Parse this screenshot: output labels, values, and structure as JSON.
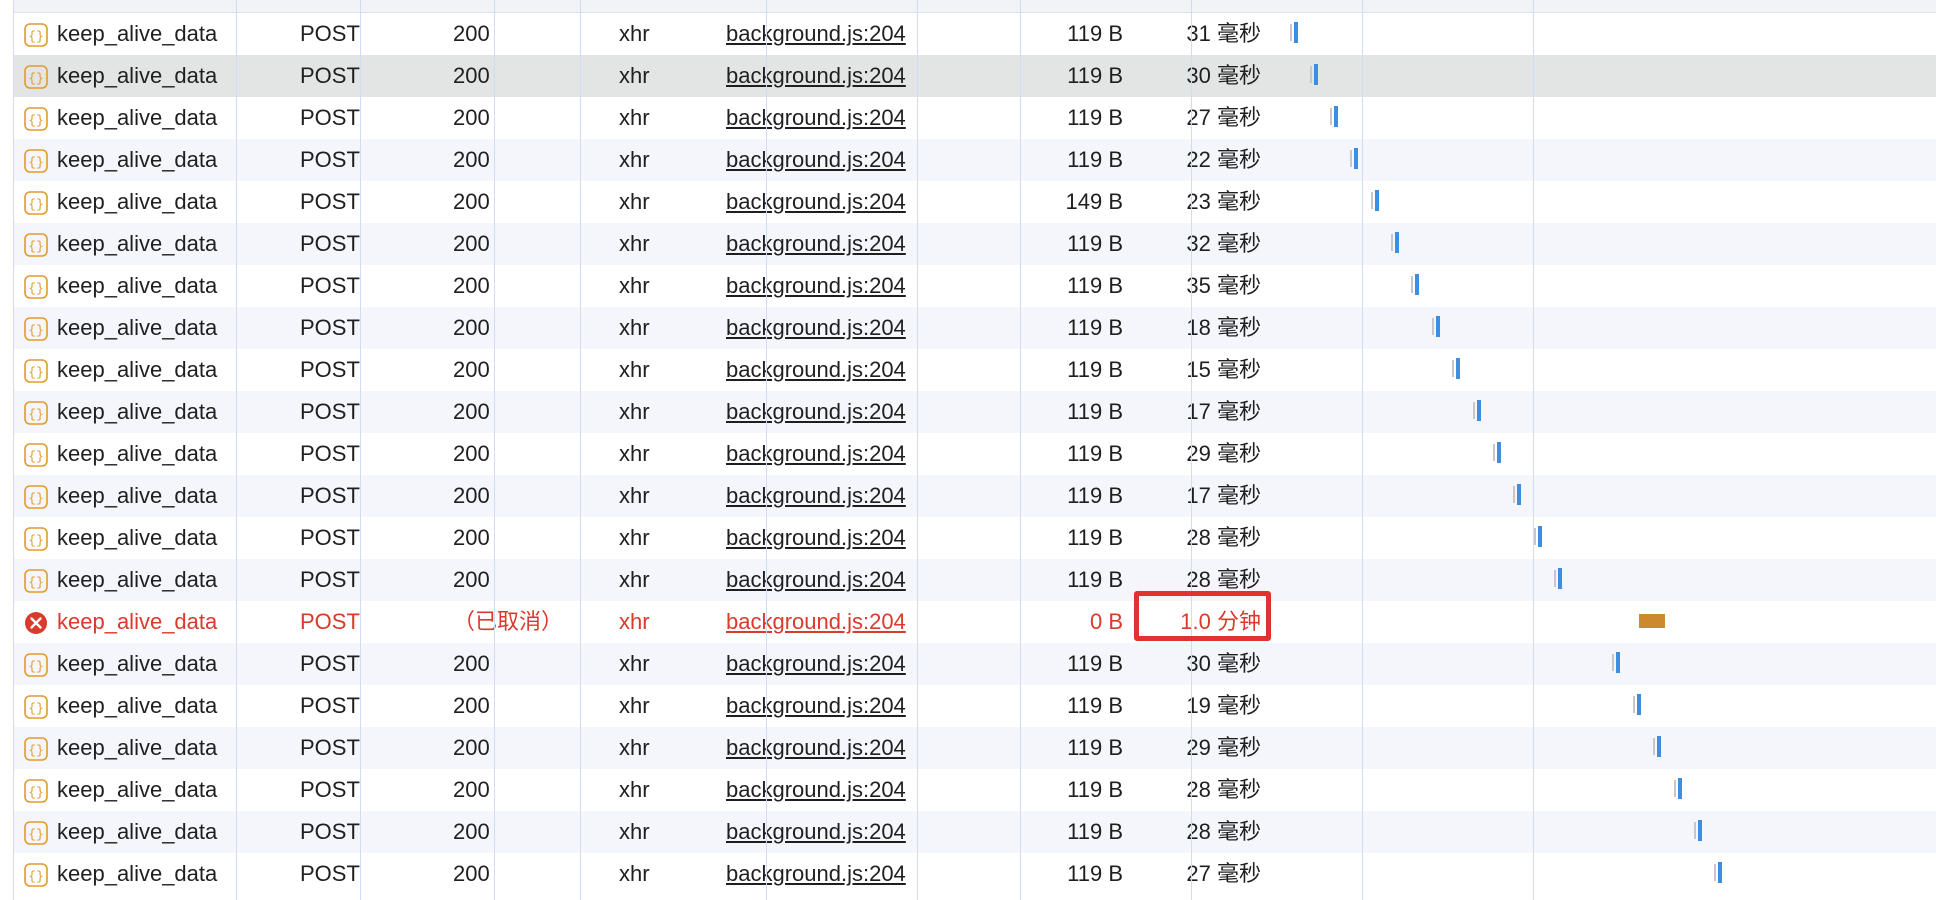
{
  "requests": [
    {
      "name": "keep_alive_data",
      "method": "POST",
      "status": "200",
      "type": "xhr",
      "initiator": "background.js:204",
      "size": "119 B",
      "time": "31 毫秒",
      "icon": "json-braces-icon",
      "state": "ok"
    },
    {
      "name": "keep_alive_data",
      "method": "POST",
      "status": "200",
      "type": "xhr",
      "initiator": "background.js:204",
      "size": "119 B",
      "time": "30 毫秒",
      "icon": "json-braces-icon",
      "state": "ok",
      "selected": true
    },
    {
      "name": "keep_alive_data",
      "method": "POST",
      "status": "200",
      "type": "xhr",
      "initiator": "background.js:204",
      "size": "119 B",
      "time": "27 毫秒",
      "icon": "json-braces-icon",
      "state": "ok"
    },
    {
      "name": "keep_alive_data",
      "method": "POST",
      "status": "200",
      "type": "xhr",
      "initiator": "background.js:204",
      "size": "119 B",
      "time": "22 毫秒",
      "icon": "json-braces-icon",
      "state": "ok"
    },
    {
      "name": "keep_alive_data",
      "method": "POST",
      "status": "200",
      "type": "xhr",
      "initiator": "background.js:204",
      "size": "149 B",
      "time": "23 毫秒",
      "icon": "json-braces-icon",
      "state": "ok"
    },
    {
      "name": "keep_alive_data",
      "method": "POST",
      "status": "200",
      "type": "xhr",
      "initiator": "background.js:204",
      "size": "119 B",
      "time": "32 毫秒",
      "icon": "json-braces-icon",
      "state": "ok"
    },
    {
      "name": "keep_alive_data",
      "method": "POST",
      "status": "200",
      "type": "xhr",
      "initiator": "background.js:204",
      "size": "119 B",
      "time": "35 毫秒",
      "icon": "json-braces-icon",
      "state": "ok"
    },
    {
      "name": "keep_alive_data",
      "method": "POST",
      "status": "200",
      "type": "xhr",
      "initiator": "background.js:204",
      "size": "119 B",
      "time": "18 毫秒",
      "icon": "json-braces-icon",
      "state": "ok"
    },
    {
      "name": "keep_alive_data",
      "method": "POST",
      "status": "200",
      "type": "xhr",
      "initiator": "background.js:204",
      "size": "119 B",
      "time": "15 毫秒",
      "icon": "json-braces-icon",
      "state": "ok"
    },
    {
      "name": "keep_alive_data",
      "method": "POST",
      "status": "200",
      "type": "xhr",
      "initiator": "background.js:204",
      "size": "119 B",
      "time": "17 毫秒",
      "icon": "json-braces-icon",
      "state": "ok"
    },
    {
      "name": "keep_alive_data",
      "method": "POST",
      "status": "200",
      "type": "xhr",
      "initiator": "background.js:204",
      "size": "119 B",
      "time": "29 毫秒",
      "icon": "json-braces-icon",
      "state": "ok"
    },
    {
      "name": "keep_alive_data",
      "method": "POST",
      "status": "200",
      "type": "xhr",
      "initiator": "background.js:204",
      "size": "119 B",
      "time": "17 毫秒",
      "icon": "json-braces-icon",
      "state": "ok"
    },
    {
      "name": "keep_alive_data",
      "method": "POST",
      "status": "200",
      "type": "xhr",
      "initiator": "background.js:204",
      "size": "119 B",
      "time": "28 毫秒",
      "icon": "json-braces-icon",
      "state": "ok"
    },
    {
      "name": "keep_alive_data",
      "method": "POST",
      "status": "200",
      "type": "xhr",
      "initiator": "background.js:204",
      "size": "119 B",
      "time": "28 毫秒",
      "icon": "json-braces-icon",
      "state": "ok"
    },
    {
      "name": "keep_alive_data",
      "method": "POST",
      "status": "（已取消）",
      "type": "xhr",
      "initiator": "background.js:204",
      "size": "0 B",
      "time": "1.0 分钟",
      "icon": "error-x-icon",
      "state": "canceled",
      "highlighted": true
    },
    {
      "name": "keep_alive_data",
      "method": "POST",
      "status": "200",
      "type": "xhr",
      "initiator": "background.js:204",
      "size": "119 B",
      "time": "30 毫秒",
      "icon": "json-braces-icon",
      "state": "ok"
    },
    {
      "name": "keep_alive_data",
      "method": "POST",
      "status": "200",
      "type": "xhr",
      "initiator": "background.js:204",
      "size": "119 B",
      "time": "19 毫秒",
      "icon": "json-braces-icon",
      "state": "ok"
    },
    {
      "name": "keep_alive_data",
      "method": "POST",
      "status": "200",
      "type": "xhr",
      "initiator": "background.js:204",
      "size": "119 B",
      "time": "29 毫秒",
      "icon": "json-braces-icon",
      "state": "ok"
    },
    {
      "name": "keep_alive_data",
      "method": "POST",
      "status": "200",
      "type": "xhr",
      "initiator": "background.js:204",
      "size": "119 B",
      "time": "28 毫秒",
      "icon": "json-braces-icon",
      "state": "ok"
    },
    {
      "name": "keep_alive_data",
      "method": "POST",
      "status": "200",
      "type": "xhr",
      "initiator": "background.js:204",
      "size": "119 B",
      "time": "28 毫秒",
      "icon": "json-braces-icon",
      "state": "ok"
    },
    {
      "name": "keep_alive_data",
      "method": "POST",
      "status": "200",
      "type": "xhr",
      "initiator": "background.js:204",
      "size": "119 B",
      "time": "27 毫秒",
      "icon": "json-braces-icon",
      "state": "ok"
    }
  ],
  "colors": {
    "error": "#d93a2b",
    "icon_json": "#e39a2c",
    "waterfall_bar": "#3b8ee0",
    "waterfall_long": "#cc8a2e",
    "highlight": "#e03330",
    "selected_row": "#e3e4e4",
    "grid": "#cfdcf4"
  }
}
